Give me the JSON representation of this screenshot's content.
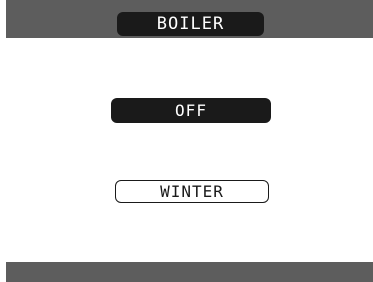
{
  "header": {
    "title": "BOILER"
  },
  "menu": {
    "options": [
      {
        "label": "OFF",
        "selected": true
      },
      {
        "label": "WINTER",
        "selected": false
      }
    ]
  },
  "colors": {
    "bar": "#5d5d5d",
    "selected_background": "#1a1a1a",
    "background": "#ffffff"
  }
}
